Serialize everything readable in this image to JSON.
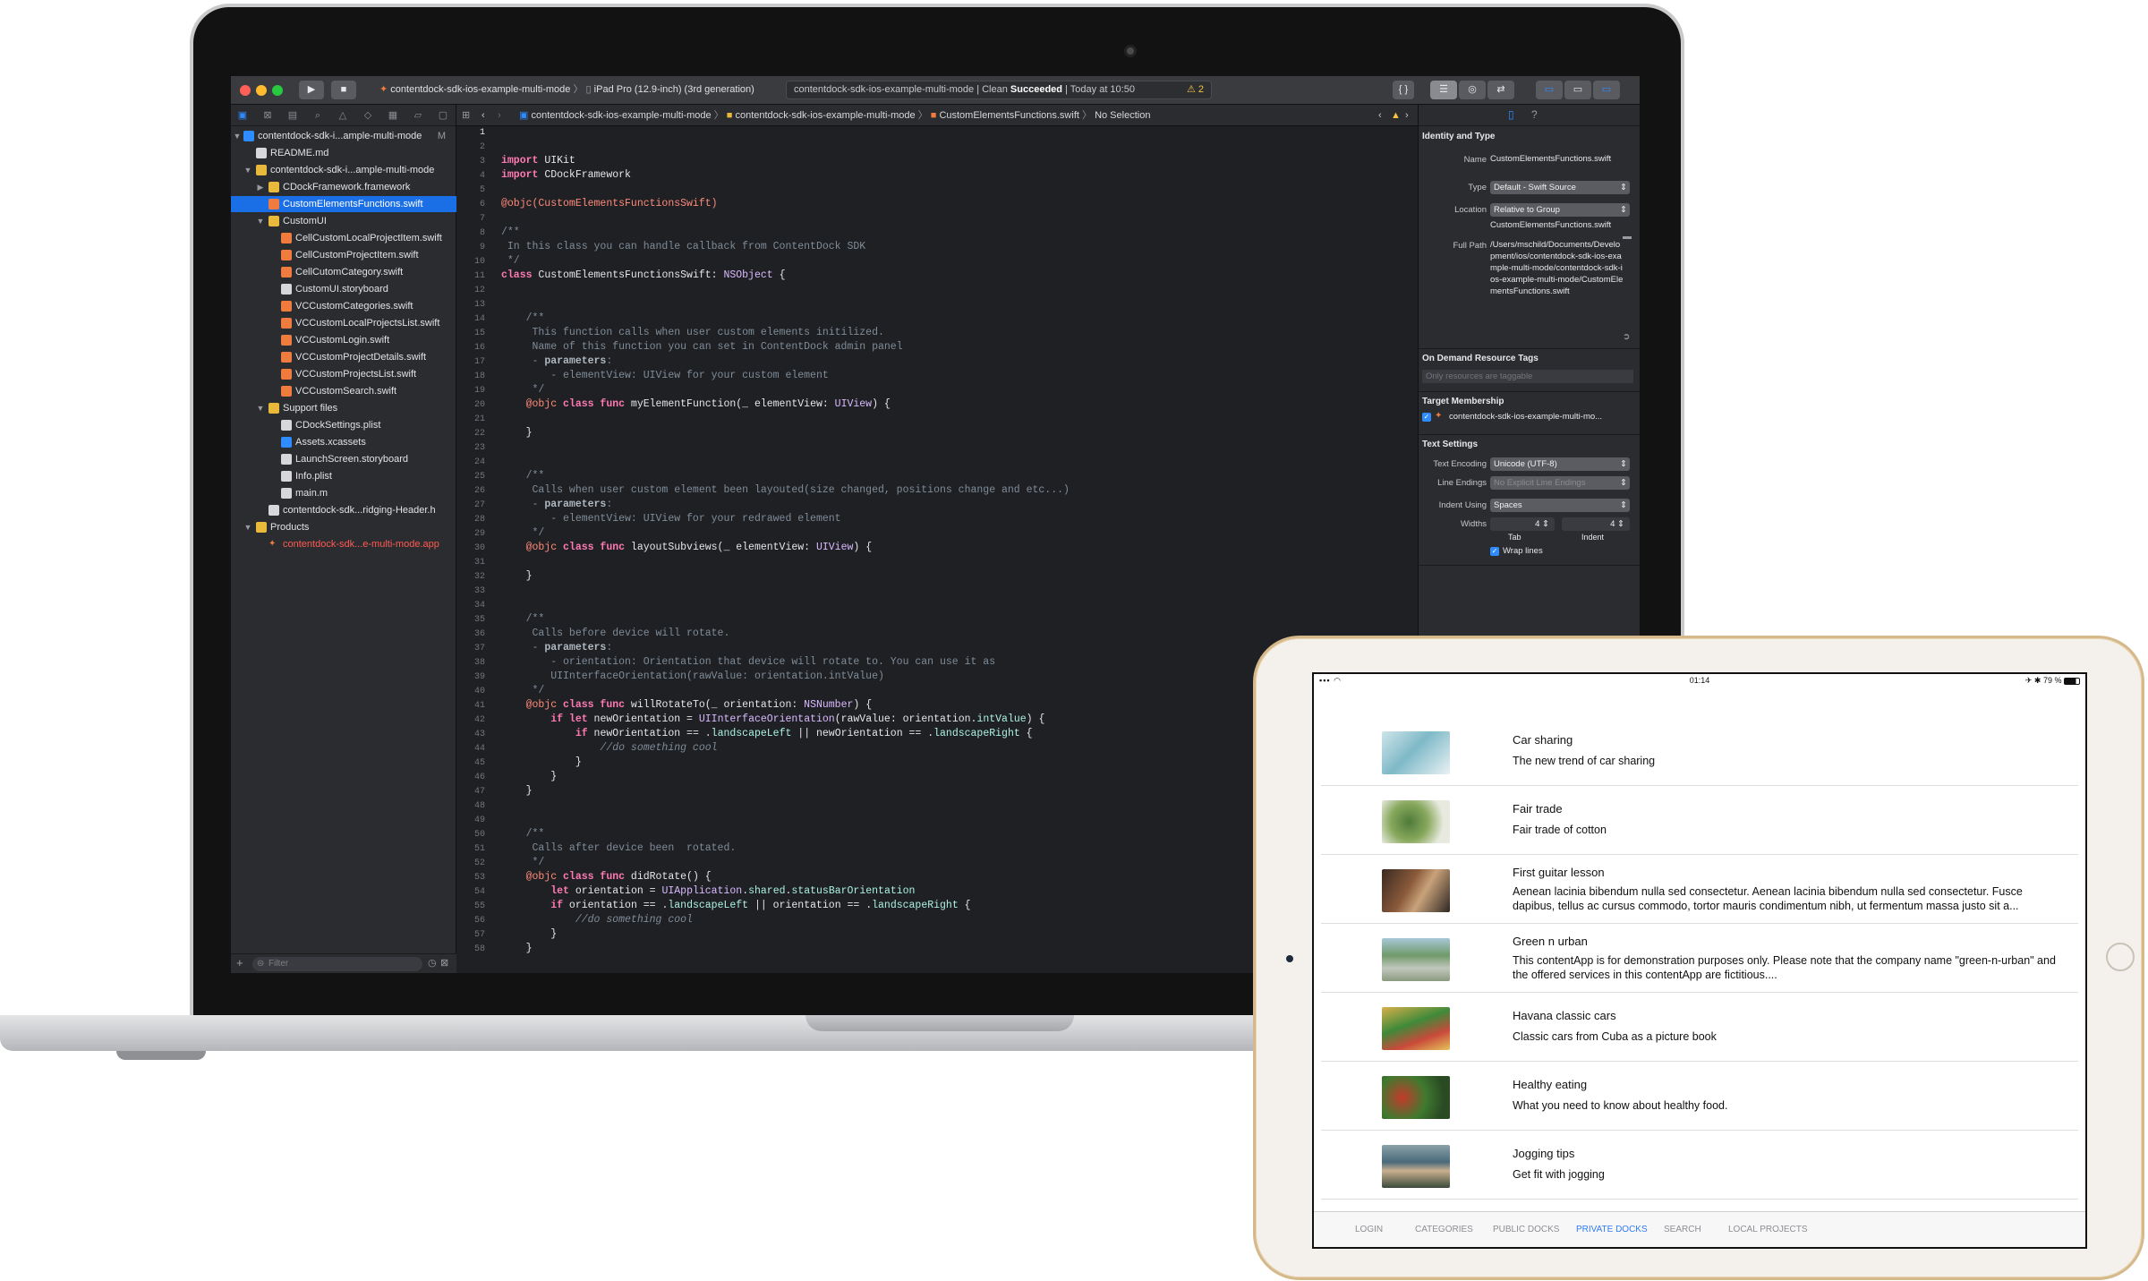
{
  "xcode": {
    "toolbar": {
      "scheme": "contentdock-sdk-ios-example-multi-mode",
      "destination": "iPad Pro (12.9-inch) (3rd generation)",
      "activity_project": "contentdock-sdk-ios-example-multi-mode",
      "activity_sep": " | Clean ",
      "activity_status": "Succeeded",
      "activity_time": " | Today at 10:50",
      "warnings": "⚠ 2",
      "library_button": "{ }"
    },
    "navigator": {
      "items": [
        {
          "label": "contentdock-sdk-i...ample-multi-mode",
          "badge": "M"
        },
        {
          "label": "README.md"
        },
        {
          "label": "contentdock-sdk-i...ample-multi-mode"
        },
        {
          "label": "CDockFramework.framework"
        },
        {
          "label": "CustomElementsFunctions.swift"
        },
        {
          "label": "CustomUI"
        },
        {
          "label": "CellCustomLocalProjectItem.swift"
        },
        {
          "label": "CellCustomProjectItem.swift"
        },
        {
          "label": "CellCutomCategory.swift"
        },
        {
          "label": "CustomUI.storyboard"
        },
        {
          "label": "VCCustomCategories.swift"
        },
        {
          "label": "VCCustomLocalProjectsList.swift"
        },
        {
          "label": "VCCustomLogin.swift"
        },
        {
          "label": "VCCustomProjectDetails.swift"
        },
        {
          "label": "VCCustomProjectsList.swift"
        },
        {
          "label": "VCCustomSearch.swift"
        },
        {
          "label": "Support files"
        },
        {
          "label": "CDockSettings.plist"
        },
        {
          "label": "Assets.xcassets"
        },
        {
          "label": "LaunchScreen.storyboard"
        },
        {
          "label": "Info.plist"
        },
        {
          "label": "main.m"
        },
        {
          "label": "contentdock-sdk...ridging-Header.h"
        },
        {
          "label": "Products"
        },
        {
          "label": "contentdock-sdk...e-multi-mode.app"
        }
      ],
      "filter_placeholder": "Filter"
    },
    "jumpbar": {
      "project": "contentdock-sdk-ios-example-multi-mode",
      "group": "contentdock-sdk-ios-example-multi-mode",
      "file": "CustomElementsFunctions.swift",
      "selection": "No Selection"
    },
    "line_numbers": [
      "1",
      "2",
      "3",
      "4",
      "5",
      "6",
      "7",
      "8",
      "9",
      "10",
      "11",
      "12",
      "13",
      "14",
      "15",
      "16",
      "17",
      "18",
      "19",
      "20",
      "21",
      "22",
      "23",
      "24",
      "25",
      "26",
      "27",
      "28",
      "29",
      "30",
      "31",
      "32",
      "33",
      "34",
      "35",
      "36",
      "37",
      "38",
      "39",
      "40",
      "41",
      "42",
      "43",
      "44",
      "45",
      "46",
      "47",
      "48",
      "49",
      "50",
      "51",
      "52",
      "53",
      "54",
      "55",
      "56",
      "57",
      "58"
    ],
    "code": {
      "l3a": "import",
      "l3b": " UIKit",
      "l4a": "import",
      "l4b": " CDockFramework",
      "l6": "@objc(CustomElementsFunctionsSwift)",
      "l8": "/**",
      "l9": " In this class you can handle callback from ContentDock SDK",
      "l10": " */",
      "l11a": "class",
      "l11b": " CustomElementsFunctionsSwift: ",
      "l11c": "NSObject",
      "l11d": " {",
      "l14": "    /**",
      "l15": "     This function calls when user custom elements initilized.",
      "l16": "     Name of this function you can set in ContentDock admin panel",
      "l17a": "     - ",
      "l17b": "parameters",
      "l17c": ":",
      "l18": "        - elementView: UIView for your custom element",
      "l19": "     */",
      "l20a": "    @objc ",
      "l20b": "class func",
      "l20c": " myElementFunction(_ elementView: ",
      "l20d": "UIView",
      "l20e": ") {",
      "l22": "    }",
      "l25": "    /**",
      "l26": "     Calls when user custom element been layouted(size changed, positions change and etc...)",
      "l27a": "     - ",
      "l27b": "parameters",
      "l27c": ":",
      "l28": "        - elementView: UIView for your redrawed element",
      "l29": "     */",
      "l30a": "    @objc ",
      "l30b": "class func",
      "l30c": " layoutSubviews(_ elementView: ",
      "l30d": "UIView",
      "l30e": ") {",
      "l32": "    }",
      "l35": "    /**",
      "l36": "     Calls before device will rotate.",
      "l37a": "     - ",
      "l37b": "parameters",
      "l37c": ":",
      "l38": "        - orientation: Orientation that device will rotate to. You can use it as",
      "l39": "        UIInterfaceOrientation(rawValue: orientation.intValue)",
      "l40": "     */",
      "l41a": "    @objc ",
      "l41b": "class func",
      "l41c": " willRotateTo(_ orientation: ",
      "l41d": "NSNumber",
      "l41e": ") {",
      "l42a": "        ",
      "l42b": "if let",
      "l42c": " newOrientation = ",
      "l42d": "UIInterfaceOrientation",
      "l42e": "(rawValue: orientation.",
      "l42f": "intValue",
      "l42g": ") {",
      "l43a": "            ",
      "l43b": "if",
      "l43c": " newOrientation == .",
      "l43d": "landscapeLeft",
      "l43e": " || newOrientation == .",
      "l43f": "landscapeRight",
      "l43g": " {",
      "l44": "                //do something cool",
      "l45": "            }",
      "l46": "        }",
      "l47": "    }",
      "l50": "    /**",
      "l51": "     Calls after device been  rotated.",
      "l52": "     */",
      "l53a": "    @objc ",
      "l53b": "class func",
      "l53c": " didRotate() {",
      "l54a": "        ",
      "l54b": "let",
      "l54c": " orientation = ",
      "l54d": "UIApplication",
      "l54e": ".",
      "l54f": "shared",
      "l54g": ".",
      "l54h": "statusBarOrientation",
      "l55a": "        ",
      "l55b": "if",
      "l55c": " orientation == .",
      "l55d": "landscapeLeft",
      "l55e": " || orientation == .",
      "l55f": "landscapeRight",
      "l55g": " {",
      "l56": "            //do something cool",
      "l57": "        }",
      "l58": "    }"
    },
    "inspector": {
      "identity_heading": "Identity and Type",
      "name_label": "Name",
      "name_value": "CustomElementsFunctions.swift",
      "type_label": "Type",
      "type_value": "Default - Swift Source",
      "location_label": "Location",
      "location_value": "Relative to Group",
      "location_file": "CustomElementsFunctions.swift",
      "fullpath_label": "Full Path",
      "fullpath_value": "/Users/mschild/Documents/Development/ios/contentdock-sdk-ios-example-multi-mode/contentdock-sdk-ios-example-multi-mode/CustomElementsFunctions.swift",
      "ondemand_heading": "On Demand Resource Tags",
      "tags_placeholder": "Only resources are taggable",
      "target_heading": "Target Membership",
      "target_item": "contentdock-sdk-ios-example-multi-mo...",
      "text_heading": "Text Settings",
      "encoding_label": "Text Encoding",
      "encoding_value": "Unicode (UTF-8)",
      "endings_label": "Line Endings",
      "endings_value": "No Explicit Line Endings",
      "indent_label": "Indent Using",
      "indent_value": "Spaces",
      "widths_label": "Widths",
      "tab_width": "4",
      "indent_width": "4",
      "tab_caption": "Tab",
      "indent_caption": "Indent",
      "wrap_label": "Wrap lines"
    }
  },
  "ipad": {
    "status": {
      "time": "01:14",
      "battery": "✈ ✱ 79 %"
    },
    "items": [
      {
        "title": "Car sharing",
        "subtitle": "The new trend of car sharing"
      },
      {
        "title": "Fair trade",
        "subtitle": "Fair trade of cotton"
      },
      {
        "title": "First guitar lesson",
        "subtitle": "Aenean lacinia bibendum nulla sed consectetur. Aenean lacinia bibendum nulla sed consectetur. Fusce dapibus, tellus ac cursus commodo, tortor mauris condimentum nibh, ut fermentum massa justo sit a..."
      },
      {
        "title": "Green n urban",
        "subtitle": "This contentApp is for demonstration purposes only. Please note that the company name \"green-n-urban\" and the offered services in this contentApp are fictitious...."
      },
      {
        "title": "Havana classic cars",
        "subtitle": "Classic cars from Cuba as a picture book"
      },
      {
        "title": "Healthy eating",
        "subtitle": "What you need to know about healthy food."
      },
      {
        "title": "Jogging tips",
        "subtitle": "Get fit with jogging"
      }
    ],
    "tabs": [
      "LOGIN",
      "CATEGORIES",
      "PUBLIC DOCKS",
      "PRIVATE DOCKS",
      "SEARCH",
      "LOCAL PROJECTS"
    ],
    "active_tab": "PRIVATE DOCKS"
  }
}
